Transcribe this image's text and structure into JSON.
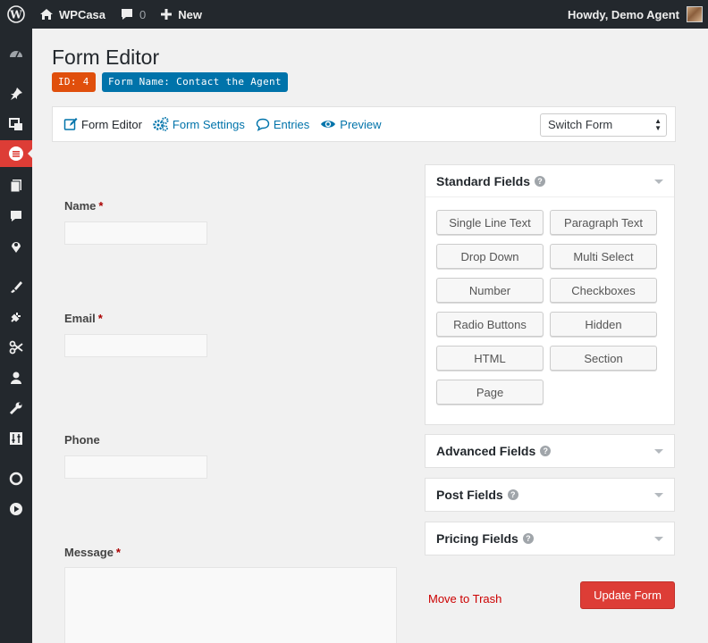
{
  "adminbar": {
    "site_name": "WPCasa",
    "comments_count": "0",
    "new_label": "New",
    "greeting": "Howdy, Demo Agent",
    "icons": [
      "wordpress-logo-icon",
      "home-icon",
      "comment-icon",
      "plus-icon"
    ]
  },
  "sidebar": {
    "icons": [
      "dashboard-icon",
      "pin-icon",
      "media-icon",
      "forms-icon",
      "pages-icon",
      "comments-icon",
      "location-icon",
      "appearance-icon",
      "plugins-icon",
      "tools-icon",
      "users-icon",
      "wrench-icon",
      "settings-icon",
      "circle-icon",
      "play-icon"
    ],
    "active": "forms-icon"
  },
  "page": {
    "title": "Form Editor",
    "id_badge": "ID: 4",
    "name_badge": "Form Name: Contact the Agent"
  },
  "tabs": [
    {
      "label": "Form Editor",
      "icon": "edit-icon"
    },
    {
      "label": "Form Settings",
      "icon": "gears-icon"
    },
    {
      "label": "Entries",
      "icon": "comment-icon"
    },
    {
      "label": "Preview",
      "icon": "eye-icon"
    }
  ],
  "switch_form": {
    "selected": "Switch Form"
  },
  "form_fields": [
    {
      "label": "Name",
      "required": "*"
    },
    {
      "label": "Email",
      "required": "*"
    },
    {
      "label": "Phone",
      "required": ""
    },
    {
      "label": "Message",
      "required": "*"
    }
  ],
  "panels": {
    "standard": {
      "title": "Standard Fields",
      "buttons": [
        "Single Line Text",
        "Paragraph Text",
        "Drop Down",
        "Multi Select",
        "Number",
        "Checkboxes",
        "Radio Buttons",
        "Hidden",
        "HTML",
        "Section",
        "Page"
      ]
    },
    "advanced": {
      "title": "Advanced Fields"
    },
    "post": {
      "title": "Post Fields"
    },
    "pricing": {
      "title": "Pricing Fields"
    },
    "help_glyph": "?"
  },
  "actions": {
    "trash": "Move to Trash",
    "update": "Update Form"
  },
  "colors": {
    "adminbar_bg": "#23282d",
    "accent_red": "#dd3d36",
    "link_blue": "#0073aa",
    "badge_orange": "#e04f0c"
  }
}
